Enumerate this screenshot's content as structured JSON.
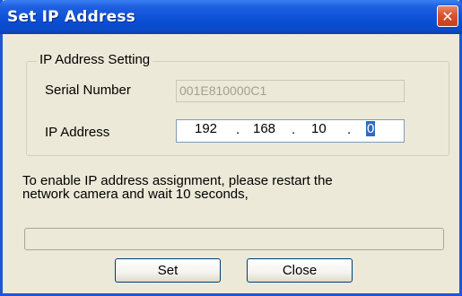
{
  "window": {
    "title": "Set IP Address",
    "close_glyph": "✕",
    "title_bar_color": "#0a4fd6",
    "close_color": "#d6532f"
  },
  "group": {
    "legend": "IP Address Setting",
    "serial_label": "Serial Number",
    "serial_value": "001E810000C1",
    "ip_label": "IP Address",
    "ip_octets": [
      "192",
      "168",
      "10",
      "0"
    ],
    "ip_separator": "."
  },
  "message": {
    "line1": "To enable IP address assignment, please restart the",
    "line2": "network camera and wait  10 seconds,"
  },
  "progress": {
    "value": 0
  },
  "buttons": {
    "set": "Set",
    "close": "Close"
  }
}
